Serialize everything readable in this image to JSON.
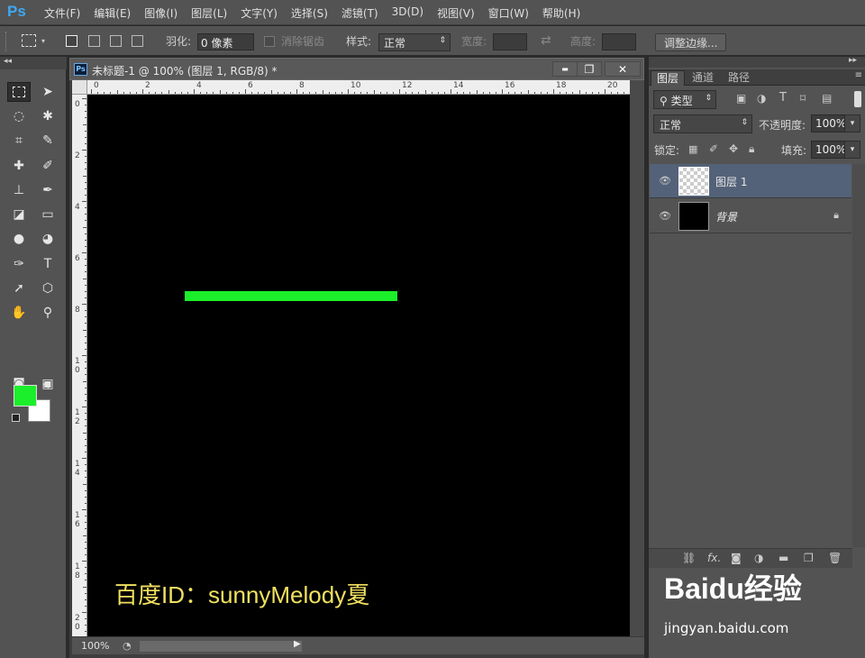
{
  "app": {
    "logo": "Ps"
  },
  "menu": [
    "文件(F)",
    "编辑(E)",
    "图像(I)",
    "图层(L)",
    "文字(Y)",
    "选择(S)",
    "滤镜(T)",
    "3D(D)",
    "视图(V)",
    "窗口(W)",
    "帮助(H)"
  ],
  "options": {
    "feather_label": "羽化:",
    "feather_value": "0 像素",
    "antialias_label": "消除锯齿",
    "style_label": "样式:",
    "style_value": "正常",
    "width_label": "宽度:",
    "height_label": "高度:",
    "refine_edge": "调整边缘..."
  },
  "toolbox": {
    "collapse": "◂◂",
    "tools": [
      "marquee",
      "move",
      "lasso",
      "magic-wand",
      "crop",
      "eyedropper",
      "spot-heal",
      "brush",
      "clone-stamp",
      "history-brush",
      "eraser",
      "gradient",
      "blur",
      "dodge",
      "pen",
      "type",
      "path-select",
      "shape",
      "hand",
      "zoom",
      "quick-mask",
      "screen-mode"
    ],
    "foreground_color": "#1bef2b",
    "background_color": "#ffffff"
  },
  "document": {
    "title": "未标题-1 @ 100% (图层 1, RGB/8) *",
    "ps_icon": "Ps",
    "minimize": "▬",
    "maximize": "❐",
    "close": "✕",
    "canvas_bg": "#000000",
    "line_color": "#1bef2b",
    "ruler_h": [
      "0",
      "2",
      "4",
      "6",
      "8",
      "10",
      "12",
      "14",
      "16",
      "18",
      "20"
    ],
    "ruler_v": [
      "0",
      "2",
      "4",
      "6",
      "8",
      "10",
      "12",
      "14",
      "16",
      "18",
      "20"
    ],
    "watermark": "百度ID：sunnyMelody夏",
    "zoom": "100%"
  },
  "panel": {
    "tabs": [
      "图层",
      "通道",
      "路径"
    ],
    "active_tab": "图层",
    "filter_kind": "类型",
    "blend_mode": "正常",
    "opacity_label": "不透明度:",
    "opacity_value": "100%",
    "lock_label": "锁定:",
    "fill_label": "填充:",
    "fill_value": "100%",
    "layers": [
      {
        "name": "图层 1",
        "selected": true,
        "thumb": "transparent"
      },
      {
        "name": "背景",
        "selected": false,
        "thumb": "black",
        "locked": true
      }
    ]
  },
  "branding": {
    "logo": "Baidu经验",
    "url": "jingyan.baidu.com"
  }
}
